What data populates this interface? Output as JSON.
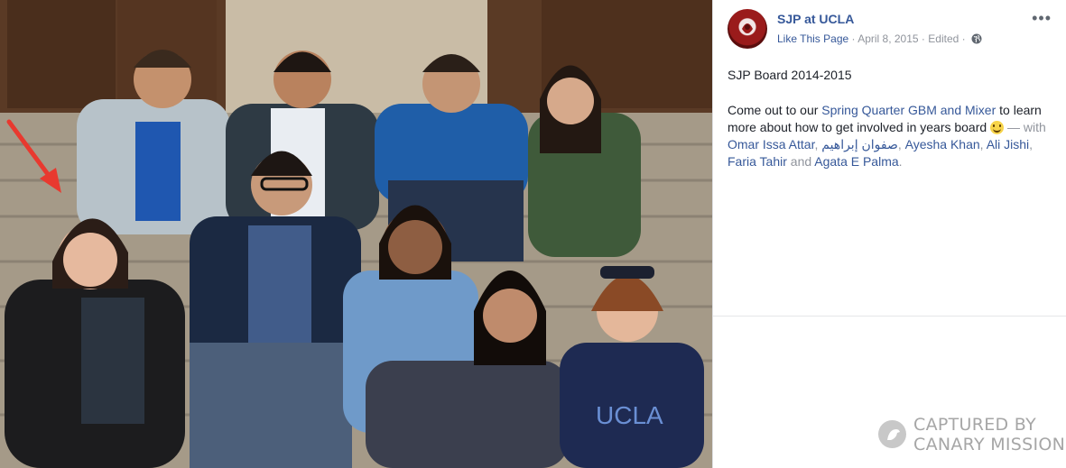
{
  "post": {
    "page_name": "SJP at UCLA",
    "like_label": "Like This Page",
    "separator": "·",
    "date": "April 8, 2015",
    "edited": "Edited",
    "more_icon": "more-options-icon",
    "title": "SJP Board 2014-2015",
    "body": {
      "intro": "Come out to our ",
      "event_link": "Spring Quarter GBM and Mixer",
      "middle": " to learn more about how to get involved in years board ",
      "with_text": " — with ",
      "tags": [
        "Omar Issa Attar",
        "صفوان إبراهيم",
        "Ayesha Khan",
        "Ali Jishi",
        "Faria Tahir",
        "Agata E Palma"
      ],
      "comma": ", ",
      "and": " and ",
      "end": "."
    }
  },
  "watermark": {
    "line1": "CAPTURED BY",
    "line2": "CANARY MISSION"
  },
  "colors": {
    "link": "#365899",
    "muted": "#90949c",
    "text": "#1d2129",
    "arrow": "#e8392f"
  },
  "photo": {
    "description_icon": "group-photo",
    "annotation": "red-arrow-icon"
  }
}
